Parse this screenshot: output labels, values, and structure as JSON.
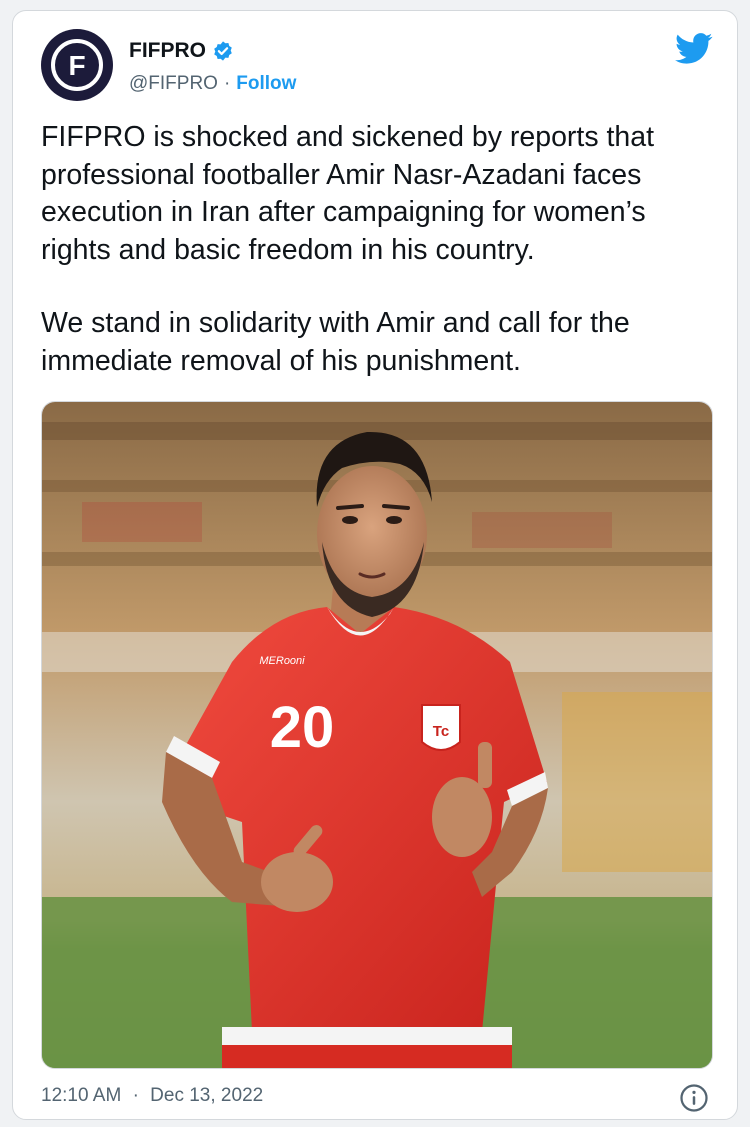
{
  "tweet": {
    "display_name": "FIFPRO",
    "handle": "@FIFPRO",
    "separator": "·",
    "follow_label": "Follow",
    "paragraphs": [
      "FIFPRO is shocked and sickened by reports that professional footballer Amir Nasr-Azadani faces execution in Iran after campaigning for women’s rights and basic freedom in his country.",
      "We stand in solidarity with Amir and call for the immediate removal of his punishment."
    ],
    "time": "12:10 AM",
    "date": "Dec 13, 2022",
    "avatar_logo_text": "F",
    "icons": [
      "fifpro-logo-icon",
      "verified-badge-icon",
      "twitter-bird-icon",
      "info-icon"
    ]
  },
  "photo": {
    "jersey_number": "20",
    "sponsor_text": "MERooni",
    "crest_text": "Tc"
  },
  "colors": {
    "brand_blue": "#1d9bf0",
    "text_primary": "#0f1419",
    "text_secondary": "#536471",
    "jersey_red": "#e8322a"
  }
}
